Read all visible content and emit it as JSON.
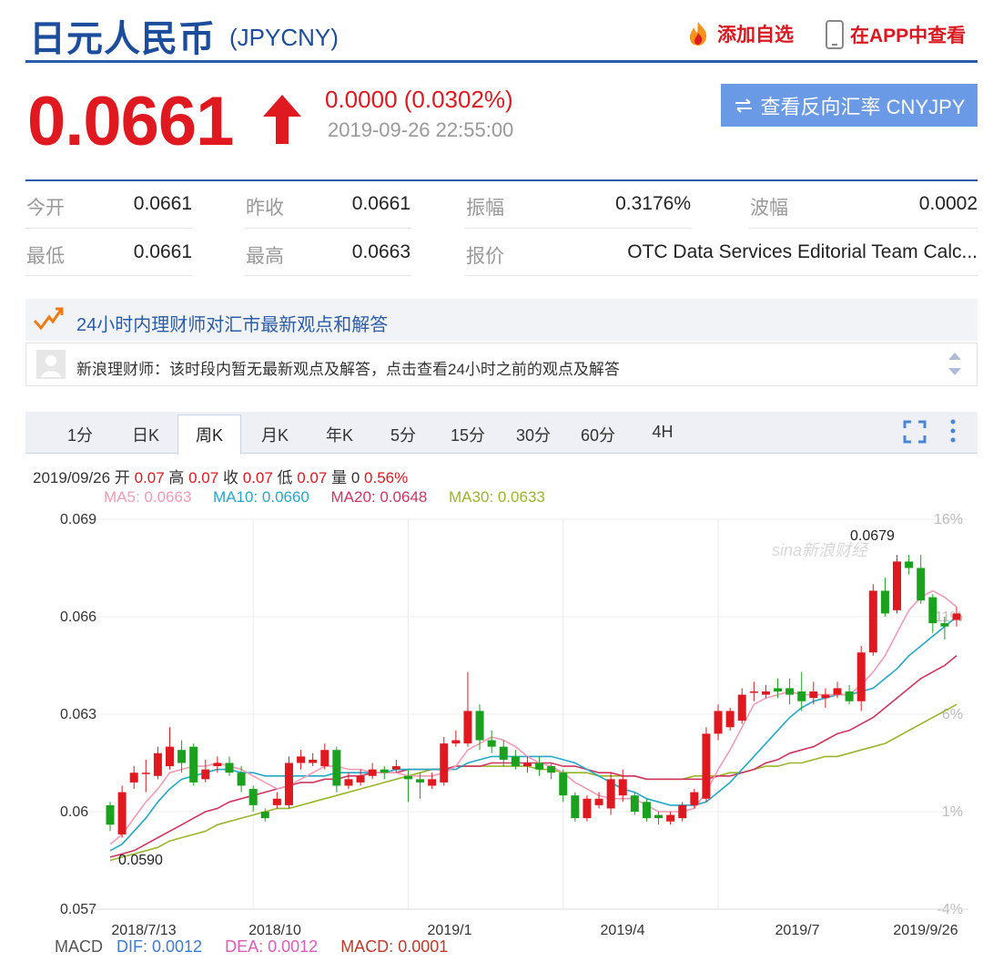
{
  "header": {
    "title": "日元人民币",
    "code": "(JPYCNY)",
    "add_favorite": "添加自选",
    "view_in_app": "在APP中查看"
  },
  "quote": {
    "price": "0.0661",
    "change": "0.0000 (0.0302%)",
    "timestamp": "2019-09-26 22:55:00",
    "reverse_button": "查看反向汇率 CNYJPY"
  },
  "stats": [
    {
      "label": "今开",
      "value": "0.0661"
    },
    {
      "label": "昨收",
      "value": "0.0661"
    },
    {
      "label": "振幅",
      "value": "0.3176%"
    },
    {
      "label": "波幅",
      "value": "0.0002"
    },
    {
      "label": "最低",
      "value": "0.0661"
    },
    {
      "label": "最高",
      "value": "0.0663"
    },
    {
      "label": "报价",
      "value": "OTC Data Services Editorial Team Calc..."
    }
  ],
  "advisor": {
    "title": "24小时内理财师对汇市最新观点和解答",
    "message": "新浪理财师：该时段内暂无最新观点及解答，点击查看24小时之前的观点及解答"
  },
  "tabs": [
    "1分",
    "日K",
    "周K",
    "月K",
    "年K",
    "5分",
    "15分",
    "30分",
    "60分",
    "4H"
  ],
  "active_tab": "周K",
  "chart_info": {
    "date": "2019/09/26",
    "open_label": "开",
    "open": "0.07",
    "high_label": "高",
    "high": "0.07",
    "close_label": "收",
    "close": "0.07",
    "low_label": "低",
    "low": "0.07",
    "volume_label": "量",
    "volume": "0",
    "pct": "0.56%"
  },
  "ma_labels": [
    {
      "text": "MA5: 0.0663",
      "color": "#f29bb5"
    },
    {
      "text": "MA10: 0.0660",
      "color": "#22a8c8"
    },
    {
      "text": "MA20: 0.0648",
      "color": "#d0345f"
    },
    {
      "text": "MA30: 0.0633",
      "color": "#99b52a"
    }
  ],
  "macd_labels": [
    {
      "text": "MACD",
      "color": "#555555"
    },
    {
      "text": "DIF: 0.0012",
      "color": "#3d7bd6"
    },
    {
      "text": "DEA: 0.0012",
      "color": "#e05ab8"
    },
    {
      "text": "MACD: 0.0001",
      "color": "#c0392b"
    }
  ],
  "watermark": "sina新浪财经",
  "colors": {
    "up": "#e0181f",
    "down": "#1aa11e",
    "brand": "#1b4d9c",
    "button": "#6a9ae6"
  },
  "chart_data": {
    "type": "candlestick",
    "y_ticks": [
      "0.069",
      "0.066",
      "0.063",
      "0.06",
      "0.057"
    ],
    "right_ticks": [
      "16%",
      "11%",
      "6%",
      "1%",
      "-4%"
    ],
    "x_ticks": [
      "2018/7/13",
      "2018/10",
      "2019/1",
      "2019/4",
      "2019/7",
      "2019/9/26"
    ],
    "ylim": [
      0.057,
      0.069
    ],
    "annotations": {
      "max": "0.0679",
      "min": "0.0590"
    },
    "candles": [
      [
        0.0602,
        0.0596,
        0.0603,
        0.0594
      ],
      [
        0.0593,
        0.0606,
        0.0608,
        0.0592
      ],
      [
        0.0609,
        0.0612,
        0.0614,
        0.0607
      ],
      [
        0.0612,
        0.0612,
        0.0616,
        0.0606
      ],
      [
        0.0611,
        0.0618,
        0.062,
        0.061
      ],
      [
        0.0614,
        0.062,
        0.0626,
        0.0613
      ],
      [
        0.0619,
        0.0615,
        0.0622,
        0.0612
      ],
      [
        0.062,
        0.0609,
        0.0621,
        0.0608
      ],
      [
        0.061,
        0.0613,
        0.0616,
        0.0609
      ],
      [
        0.0614,
        0.0615,
        0.0617,
        0.0612
      ],
      [
        0.0615,
        0.0612,
        0.0617,
        0.0611
      ],
      [
        0.0612,
        0.0608,
        0.0614,
        0.0606
      ],
      [
        0.0607,
        0.0602,
        0.0608,
        0.06
      ],
      [
        0.06,
        0.0598,
        0.0601,
        0.0597
      ],
      [
        0.0602,
        0.0604,
        0.0606,
        0.0601
      ],
      [
        0.0602,
        0.0615,
        0.0617,
        0.0601
      ],
      [
        0.0615,
        0.0617,
        0.0619,
        0.0613
      ],
      [
        0.0615,
        0.0616,
        0.0618,
        0.0614
      ],
      [
        0.0614,
        0.0619,
        0.0621,
        0.0613
      ],
      [
        0.0619,
        0.0608,
        0.062,
        0.0606
      ],
      [
        0.0608,
        0.061,
        0.0612,
        0.0607
      ],
      [
        0.0609,
        0.0611,
        0.0613,
        0.0608
      ],
      [
        0.0611,
        0.0613,
        0.0615,
        0.061
      ],
      [
        0.0613,
        0.0612,
        0.0614,
        0.061
      ],
      [
        0.0613,
        0.0614,
        0.0616,
        0.0612
      ],
      [
        0.0611,
        0.061,
        0.0613,
        0.0603
      ],
      [
        0.061,
        0.0609,
        0.0612,
        0.0604
      ],
      [
        0.0608,
        0.061,
        0.0612,
        0.0607
      ],
      [
        0.0609,
        0.0621,
        0.0623,
        0.0608
      ],
      [
        0.0621,
        0.0622,
        0.0625,
        0.062
      ],
      [
        0.0621,
        0.0631,
        0.0643,
        0.062
      ],
      [
        0.0631,
        0.0622,
        0.0633,
        0.0619
      ],
      [
        0.0622,
        0.062,
        0.0625,
        0.0618
      ],
      [
        0.062,
        0.0616,
        0.0622,
        0.0614
      ],
      [
        0.0617,
        0.0614,
        0.0619,
        0.0613
      ],
      [
        0.0614,
        0.0615,
        0.0617,
        0.0612
      ],
      [
        0.0615,
        0.0613,
        0.0617,
        0.0611
      ],
      [
        0.0614,
        0.0612,
        0.0615,
        0.061
      ],
      [
        0.0612,
        0.0605,
        0.0613,
        0.0603
      ],
      [
        0.0605,
        0.0598,
        0.0606,
        0.0597
      ],
      [
        0.0598,
        0.0604,
        0.0605,
        0.0597
      ],
      [
        0.0602,
        0.0604,
        0.0606,
        0.0601
      ],
      [
        0.0601,
        0.061,
        0.0612,
        0.0599
      ],
      [
        0.0605,
        0.061,
        0.0613,
        0.0603
      ],
      [
        0.0605,
        0.06,
        0.0606,
        0.0599
      ],
      [
        0.0603,
        0.0598,
        0.0604,
        0.0597
      ],
      [
        0.0599,
        0.0598,
        0.06,
        0.0596
      ],
      [
        0.0597,
        0.0599,
        0.06,
        0.0596
      ],
      [
        0.0598,
        0.0602,
        0.0603,
        0.0597
      ],
      [
        0.0602,
        0.0606,
        0.0607,
        0.0601
      ],
      [
        0.0604,
        0.0624,
        0.0626,
        0.0603
      ],
      [
        0.0624,
        0.0631,
        0.0633,
        0.0622
      ],
      [
        0.0626,
        0.0631,
        0.0632,
        0.0625
      ],
      [
        0.0628,
        0.0636,
        0.0638,
        0.0627
      ],
      [
        0.0637,
        0.0637,
        0.064,
        0.0634
      ],
      [
        0.0636,
        0.0637,
        0.0639,
        0.0635
      ],
      [
        0.0638,
        0.0637,
        0.0641,
        0.0635
      ],
      [
        0.0638,
        0.0636,
        0.0641,
        0.0633
      ],
      [
        0.0637,
        0.0634,
        0.0643,
        0.0631
      ],
      [
        0.0635,
        0.0637,
        0.064,
        0.0633
      ],
      [
        0.0635,
        0.0636,
        0.0638,
        0.0632
      ],
      [
        0.0636,
        0.0638,
        0.064,
        0.0635
      ],
      [
        0.0637,
        0.0634,
        0.0639,
        0.0633
      ],
      [
        0.0634,
        0.0649,
        0.0651,
        0.0631
      ],
      [
        0.0649,
        0.0668,
        0.067,
        0.0648
      ],
      [
        0.0668,
        0.0661,
        0.0672,
        0.066
      ],
      [
        0.0662,
        0.0677,
        0.0679,
        0.0661
      ],
      [
        0.0677,
        0.0675,
        0.0679,
        0.0673
      ],
      [
        0.0675,
        0.0665,
        0.0679,
        0.0664
      ],
      [
        0.0666,
        0.0658,
        0.0667,
        0.0655
      ],
      [
        0.0658,
        0.0657,
        0.066,
        0.0653
      ],
      [
        0.0659,
        0.0661,
        0.0663,
        0.0657
      ]
    ],
    "ma5": [
      0.059,
      0.0593,
      0.0598,
      0.0603,
      0.0607,
      0.0612,
      0.0613,
      0.0614,
      0.0614,
      0.0615,
      0.0614,
      0.0613,
      0.0611,
      0.0609,
      0.0607,
      0.0608,
      0.061,
      0.0612,
      0.0614,
      0.0614,
      0.0613,
      0.0613,
      0.0612,
      0.0612,
      0.0612,
      0.0611,
      0.0611,
      0.0611,
      0.0612,
      0.0614,
      0.0619,
      0.0621,
      0.0623,
      0.0622,
      0.062,
      0.0617,
      0.0615,
      0.0614,
      0.0612,
      0.0609,
      0.0607,
      0.0605,
      0.0604,
      0.0604,
      0.0604,
      0.0602,
      0.06,
      0.06,
      0.06,
      0.0601,
      0.0606,
      0.0613,
      0.0619,
      0.0626,
      0.0633,
      0.0635,
      0.0636,
      0.0637,
      0.0636,
      0.0636,
      0.0636,
      0.0636,
      0.0636,
      0.0639,
      0.0643,
      0.0648,
      0.0655,
      0.0662,
      0.0666,
      0.0668,
      0.0666,
      0.0663
    ],
    "ma10": [
      0.0588,
      0.059,
      0.0594,
      0.0598,
      0.0603,
      0.0607,
      0.061,
      0.0611,
      0.0612,
      0.0613,
      0.0613,
      0.0612,
      0.0612,
      0.0611,
      0.0611,
      0.0611,
      0.0611,
      0.0611,
      0.0611,
      0.0612,
      0.0612,
      0.0612,
      0.0612,
      0.0612,
      0.0613,
      0.0613,
      0.0613,
      0.0613,
      0.0613,
      0.0613,
      0.0615,
      0.0616,
      0.0617,
      0.0617,
      0.0617,
      0.0617,
      0.0617,
      0.0617,
      0.0616,
      0.0615,
      0.0613,
      0.0611,
      0.0609,
      0.0607,
      0.0606,
      0.0604,
      0.0603,
      0.0602,
      0.0602,
      0.0602,
      0.0603,
      0.0606,
      0.0609,
      0.0613,
      0.0617,
      0.0621,
      0.0625,
      0.0629,
      0.0632,
      0.0634,
      0.0635,
      0.0636,
      0.0636,
      0.0637,
      0.0638,
      0.0641,
      0.0644,
      0.0648,
      0.0651,
      0.0654,
      0.0657,
      0.066
    ],
    "ma20": [
      0.0586,
      0.0587,
      0.0588,
      0.059,
      0.0592,
      0.0594,
      0.0596,
      0.0598,
      0.06,
      0.0601,
      0.0603,
      0.0604,
      0.0605,
      0.0606,
      0.0607,
      0.0608,
      0.0609,
      0.0609,
      0.061,
      0.061,
      0.0611,
      0.0611,
      0.0612,
      0.0612,
      0.0612,
      0.0613,
      0.0613,
      0.0613,
      0.0613,
      0.0614,
      0.0614,
      0.0614,
      0.0615,
      0.0615,
      0.0615,
      0.0615,
      0.0615,
      0.0615,
      0.0614,
      0.0614,
      0.0613,
      0.0612,
      0.0612,
      0.0611,
      0.0611,
      0.061,
      0.061,
      0.061,
      0.061,
      0.061,
      0.061,
      0.0611,
      0.0611,
      0.0612,
      0.0613,
      0.0615,
      0.0616,
      0.0618,
      0.0619,
      0.062,
      0.0622,
      0.0624,
      0.0625,
      0.0627,
      0.0629,
      0.0632,
      0.0635,
      0.0638,
      0.0641,
      0.0643,
      0.0645,
      0.0648
    ],
    "ma30": [
      0.0585,
      0.0586,
      0.0587,
      0.0588,
      0.0589,
      0.0591,
      0.0592,
      0.0593,
      0.0594,
      0.0596,
      0.0597,
      0.0598,
      0.0599,
      0.06,
      0.0601,
      0.0601,
      0.0602,
      0.0603,
      0.0604,
      0.0605,
      0.0606,
      0.0607,
      0.0608,
      0.0609,
      0.061,
      0.0611,
      0.0612,
      0.0613,
      0.0613,
      0.0614,
      0.0614,
      0.0614,
      0.0614,
      0.0614,
      0.0614,
      0.0614,
      0.0613,
      0.0613,
      0.0612,
      0.0612,
      0.0612,
      0.0611,
      0.0611,
      0.0611,
      0.0611,
      0.061,
      0.061,
      0.061,
      0.061,
      0.0611,
      0.0611,
      0.0611,
      0.0612,
      0.0612,
      0.0613,
      0.0614,
      0.0614,
      0.0615,
      0.0615,
      0.0616,
      0.0617,
      0.0617,
      0.0618,
      0.0619,
      0.062,
      0.0621,
      0.0623,
      0.0625,
      0.0627,
      0.0629,
      0.0631,
      0.0633
    ]
  }
}
